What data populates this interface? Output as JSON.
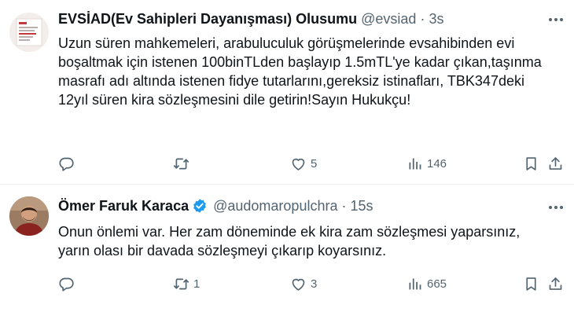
{
  "tweets": [
    {
      "name": "EVSİAD(Ev Sahipleri Dayanışması) Olusumu",
      "handle": "@evsiad",
      "sep": "·",
      "time": "3s",
      "text": "Uzun süren mahkemeleri, arabuluculuk görüşmelerinde evsahibinden evi boşaltmak için istenen 100binTLden başlayıp 1.5mTL'ye kadar çıkan,taşınma masrafı adı altında istenen fidye tutarlarını,gereksiz istinafları, TBK347deki 12yıl süren kira sözleşmesini dile getirin!Sayın Hukukçu!",
      "replies": "",
      "retweets": "",
      "likes": "5",
      "views": "146",
      "verified": false
    },
    {
      "name": "Ömer Faruk Karaca",
      "handle": "@audomaropulchra",
      "sep": "·",
      "time": "15s",
      "text": "Onun önlemi var. Her zam döneminde ek kira zam sözleşmesi yaparsınız, yarın olası bir davada sözleşmeyi çıkarıp koyarsınız.",
      "replies": "",
      "retweets": "1",
      "likes": "3",
      "views": "665",
      "verified": true
    }
  ],
  "colors": {
    "verified": "#1d9bf0",
    "muted": "#536471",
    "text": "#0f1419",
    "divider": "#eff3f4"
  },
  "icons": [
    "reply-icon",
    "retweet-icon",
    "like-icon",
    "views-icon",
    "bookmark-icon",
    "share-icon",
    "more-icon",
    "verified-badge-icon"
  ]
}
